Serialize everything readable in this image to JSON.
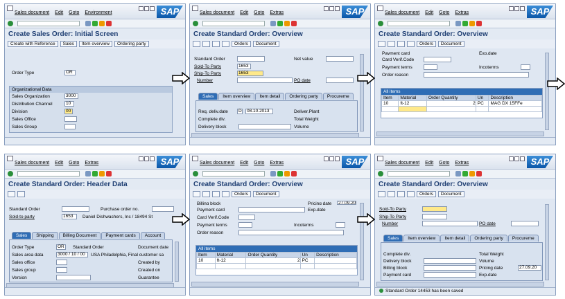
{
  "menus": {
    "panel1": [
      "Sales document",
      "Edit",
      "Goto",
      "Environment"
    ],
    "panel2": [
      "Sales document",
      "Edit",
      "Goto",
      "Extras"
    ],
    "panel3": [
      "Sales document",
      "Edit",
      "Goto",
      "Extras"
    ],
    "panel4": [
      "Sales document",
      "Edit",
      "Goto",
      "Extras"
    ],
    "panel5": [
      "Sales document",
      "Edit",
      "Goto",
      "Extras"
    ],
    "panel6": [
      "Sales document",
      "Edit",
      "Goto",
      "Extras"
    ]
  },
  "logo": "SAP",
  "p1": {
    "title": "Create Sales Order: Initial Screen",
    "buttons": [
      "Create with Reference",
      "Sales",
      "Item overview",
      "Ordering party"
    ],
    "order_type_label": "Order Type",
    "order_type": "OR",
    "org_header": "Organizational Data",
    "sales_org_label": "Sales Organization",
    "sales_org": "3000",
    "dist_channel_label": "Distribution Channel",
    "dist_channel": "10",
    "division_label": "Division",
    "division": "00",
    "sales_office_label": "Sales Office",
    "sales_group_label": "Sales Group"
  },
  "p2": {
    "title": "Create Standard Order: Overview",
    "orders_btn": "Orders",
    "document_btn": "Document",
    "std_order_label": "Standard Order",
    "net_value_label": "Net value",
    "sold_to_label": "Sold-To Party",
    "sold_to": "1653",
    "ship_to_label": "Ship-To Party",
    "ship_to": "1653",
    "po_number_label": "Number",
    "po_date_label": "PO date",
    "tabs": [
      "Sales",
      "Item overview",
      "Item detail",
      "Ordering party",
      "Procureme"
    ],
    "req_deliv_label": "Req. deliv.date",
    "req_deliv_unit": "D",
    "req_deliv": "08.10.2013",
    "deliver_plant_label": "Deliver.Plant",
    "complete_label": "Complete dlv.",
    "total_weight_label": "Total Weight",
    "delivery_block_label": "Delivery block",
    "volume_label": "Volume"
  },
  "p3": {
    "title": "Create Standard Order: Overview",
    "orders_btn": "Orders",
    "document_btn": "Document",
    "payment_card_label": "Payment card",
    "exp_date_label": "Exp.date",
    "card_verif_label": "Card Verif.Code",
    "payment_terms_label": "Payment terms",
    "incoterms_label": "Incoterms",
    "order_reason_label": "Order reason",
    "grid_title": "All items",
    "cols": [
      "Item",
      "Material",
      "Order Quantity",
      "Un",
      "Description"
    ],
    "row": {
      "item": "10",
      "material": "ft-12",
      "qty": "2",
      "un": "PC",
      "desc": "MAG DX 15FFe"
    }
  },
  "p4": {
    "title": "Create Standard Order: Header Data",
    "std_order_label": "Standard Order",
    "po_no_label": "Purchase order no.",
    "sold_to_label": "Sold-to party",
    "sold_to": "1653",
    "sold_to_name": "Daniel Dishwashers, Inc / 18494 St",
    "tabs": [
      "Sales",
      "Shipping",
      "Billing Document",
      "Payment cards",
      "Account"
    ],
    "order_type_label": "Order Type",
    "order_type": "OR",
    "std_order_sub": "Standard Order",
    "doc_date_label": "Document date",
    "sales_area_label": "Sales area data",
    "sales_area": "3000 / 10 / 00",
    "sales_area_text": "USA Philadelphia, Final customer sa",
    "created_by_label": "Created by",
    "sales_office_label": "Sales office",
    "sales_group_label": "Sales group",
    "created_on_label": "Created on",
    "version_label": "Version",
    "guarantee_label": "Guarantee"
  },
  "p5": {
    "title": "Create Standard Order: Overview",
    "orders_btn": "Orders",
    "document_btn": "Document",
    "billing_block_label": "Billing block",
    "pricing_date_label": "Pricing date",
    "pricing_date": "27.09.20",
    "payment_card_label": "Payment card",
    "exp_date_label": "Exp.date",
    "card_verif_label": "Card Verif.Code",
    "payment_terms_label": "Payment terms",
    "incoterms_label": "Incoterms",
    "order_reason_label": "Order reason",
    "grid_title": "All items",
    "cols": [
      "Item",
      "Material",
      "Order Quantity",
      "Un",
      "Description"
    ],
    "row": {
      "item": "10",
      "material": "ft-12",
      "qty": "2",
      "un": "PC",
      "desc": ""
    }
  },
  "p6": {
    "title": "Create Standard Order: Overview",
    "orders_btn": "Orders",
    "document_btn": "Document",
    "sold_to_label": "Sold-To Party",
    "ship_to_label": "Ship-To Party",
    "po_number_label": "Number",
    "po_date_label": "PO date",
    "tabs": [
      "Sales",
      "Item overview",
      "Item detail",
      "Ordering party",
      "Procureme"
    ],
    "complete_label": "Complete dlv.",
    "total_weight_label": "Total Weight",
    "delivery_block_label": "Delivery block",
    "volume_label": "Volume",
    "billing_block_label": "Billing block",
    "pricing_date_label": "Pricing date",
    "pricing_date": "27.09.20",
    "payment_card_label": "Payment card",
    "exp_date_label": "Exp.date",
    "status": "Standard Order 14453 has been saved"
  }
}
